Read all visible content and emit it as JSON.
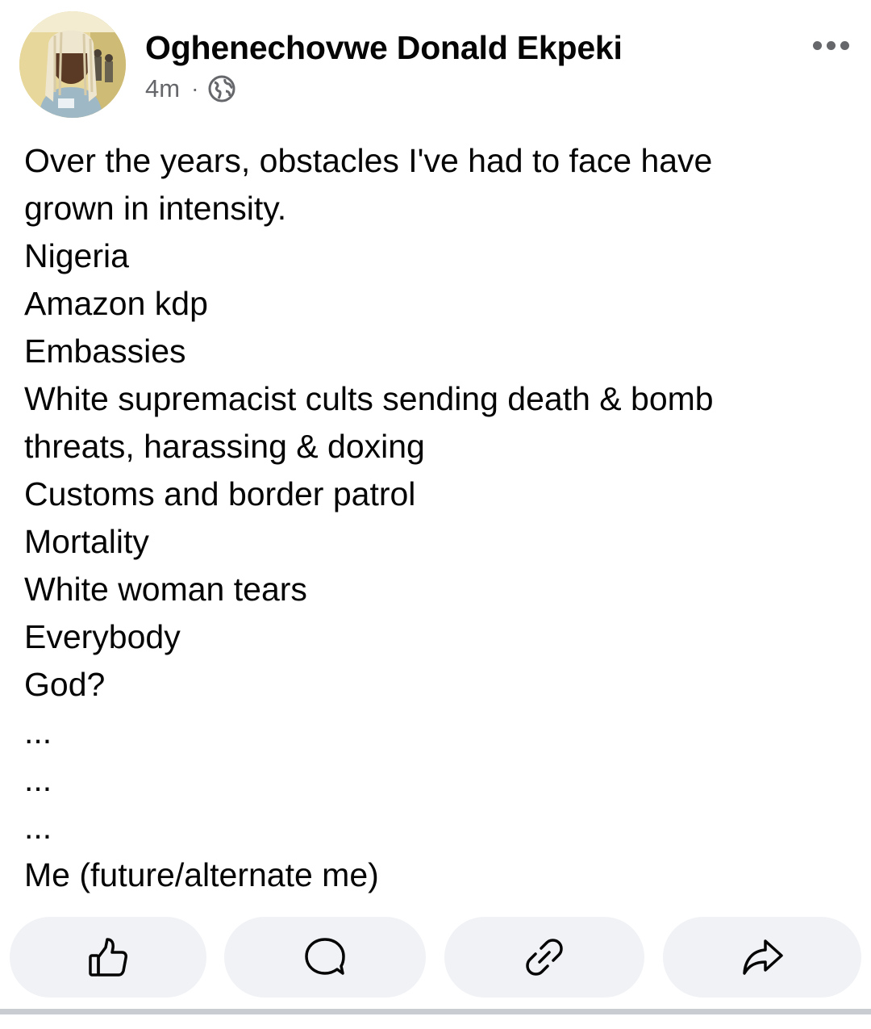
{
  "post": {
    "author": "Oghenechovwe Donald Ekpeki",
    "timestamp": "4m",
    "separator": "·",
    "privacy_icon": "globe-icon",
    "more_icon": "more-options-icon",
    "body_lines": [
      "Over the years, obstacles I've had to face have",
      "grown in intensity.",
      "Nigeria",
      "Amazon kdp",
      "Embassies",
      "White supremacist cults sending death & bomb",
      "threats, harassing & doxing",
      "Customs and border patrol",
      "Mortality",
      "White woman tears",
      "Everybody",
      "God?",
      "...",
      "...",
      "...",
      "Me (future/alternate me)"
    ]
  },
  "actions": {
    "like_icon": "thumbs-up-icon",
    "comment_icon": "comment-icon",
    "copy_link_icon": "link-icon",
    "share_icon": "share-icon"
  },
  "colors": {
    "text": "#050505",
    "secondary_text": "#65676b",
    "button_background": "#f0f2f5",
    "divider": "#c9ccd1"
  }
}
